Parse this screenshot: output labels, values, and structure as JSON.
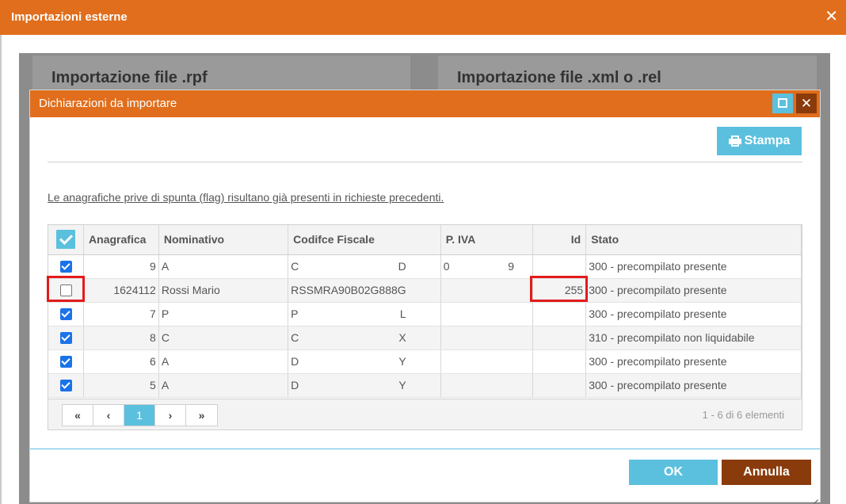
{
  "window": {
    "title": "Importazioni esterne",
    "close_glyph": "✕"
  },
  "panels": {
    "rpf_title": "Importazione file .rpf",
    "xml_title": "Importazione file .xml o .rel"
  },
  "dialog": {
    "title": "Dichiarazioni da importare",
    "close_glyph": "✕",
    "print_label": "Stampa",
    "info_text": "Le anagrafiche prive di spunta (flag) risultano già presenti in richieste precedenti.",
    "ok_label": "OK",
    "cancel_label": "Annulla"
  },
  "table": {
    "headers": {
      "anagrafica": "Anagrafica",
      "nominativo": "Nominativo",
      "codice_fiscale": "Codifce Fiscale",
      "piva": "P. IVA",
      "id": "Id",
      "stato": "Stato"
    },
    "rows": [
      {
        "checked": true,
        "anagrafica": "9",
        "nominativo": "A",
        "cf_start": "C",
        "cf_end": "D",
        "piva_start": "0",
        "piva_end": "9",
        "id": "",
        "stato": "300 - precompilato presente"
      },
      {
        "checked": false,
        "anagrafica": "1624112",
        "nominativo": "Rossi Mario",
        "cf_start": "RSSMRA90B02G888G",
        "cf_end": "",
        "piva_start": "",
        "piva_end": "",
        "id": "255",
        "stato": "300 - precompilato presente"
      },
      {
        "checked": true,
        "anagrafica": "7",
        "nominativo": "P",
        "cf_start": "P",
        "cf_end": "L",
        "piva_start": "",
        "piva_end": "",
        "id": "",
        "stato": "300 - precompilato presente"
      },
      {
        "checked": true,
        "anagrafica": "8",
        "nominativo": "C",
        "cf_start": "C",
        "cf_end": "X",
        "piva_start": "",
        "piva_end": "",
        "id": "",
        "stato": "310 - precompilato non liquidabile"
      },
      {
        "checked": true,
        "anagrafica": "6",
        "nominativo": "A",
        "cf_start": "D",
        "cf_end": "Y",
        "piva_start": "",
        "piva_end": "",
        "id": "",
        "stato": "300 - precompilato presente"
      },
      {
        "checked": true,
        "anagrafica": "5",
        "nominativo": "A",
        "cf_start": "D",
        "cf_end": "Y",
        "piva_start": "",
        "piva_end": "",
        "id": "",
        "stato": "300 - precompilato presente"
      }
    ]
  },
  "pager": {
    "first": "«",
    "prev": "‹",
    "current": "1",
    "next": "›",
    "last": "»",
    "info": "1 - 6 di 6 elementi"
  },
  "colors": {
    "header_orange": "#e06e1c",
    "accent_blue": "#5bc0de",
    "dark_brown": "#8a3b0c",
    "highlight_red": "#e21b1b",
    "checkbox_blue": "#1a73e8"
  },
  "icons": {
    "close": "close-icon",
    "maximize": "maximize-icon",
    "print": "printer-icon",
    "check": "check-icon"
  }
}
